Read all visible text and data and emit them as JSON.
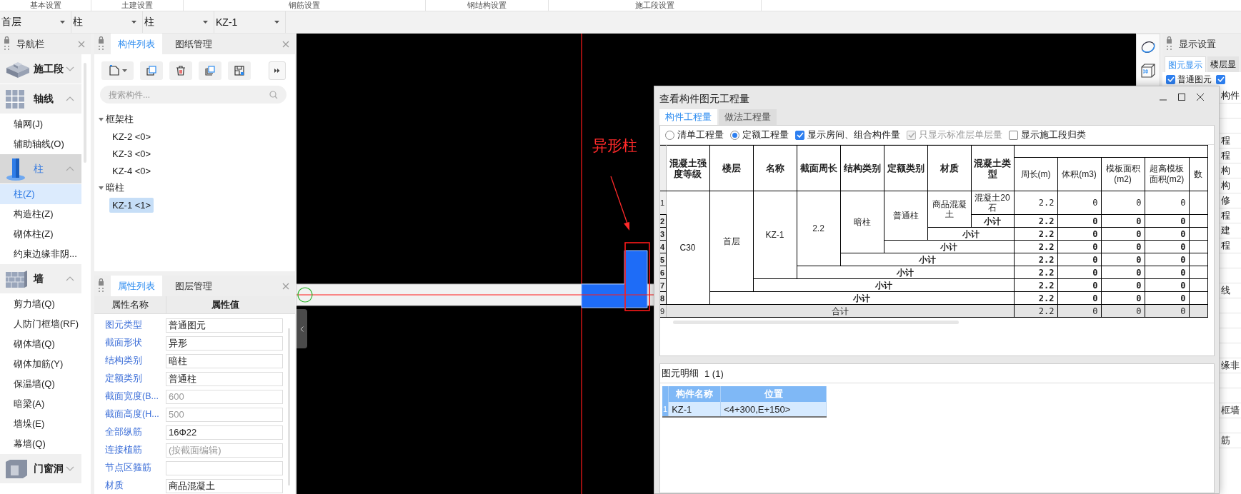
{
  "top_tabs": [
    {
      "label": "基本设置"
    },
    {
      "label": "土建设置"
    },
    {
      "label": "钢筋设置"
    },
    {
      "label": "钢结构设置"
    },
    {
      "label": "施工段设置"
    }
  ],
  "selectors": [
    {
      "value": "首层"
    },
    {
      "value": "柱"
    },
    {
      "value": "柱"
    },
    {
      "value": "KZ-1"
    }
  ],
  "navigation": {
    "title": "导航栏",
    "groups": [
      {
        "label": "施工段",
        "expanded": false,
        "selected": false
      },
      {
        "label": "轴线",
        "expanded": true,
        "selected": false,
        "items": [
          {
            "label": "轴网(J)",
            "selected": false
          },
          {
            "label": "辅助轴线(O)",
            "selected": false
          }
        ]
      },
      {
        "label": "柱",
        "expanded": true,
        "selected": true,
        "items": [
          {
            "label": "柱(Z)",
            "selected": true
          },
          {
            "label": "构造柱(Z)",
            "selected": false
          },
          {
            "label": "砌体柱(Z)",
            "selected": false
          },
          {
            "label": "约束边缘非阴...",
            "selected": false
          }
        ]
      },
      {
        "label": "墙",
        "expanded": true,
        "selected": false,
        "items": [
          {
            "label": "剪力墙(Q)",
            "selected": false
          },
          {
            "label": "人防门框墙(RF)",
            "selected": false
          },
          {
            "label": "砌体墙(Q)",
            "selected": false
          },
          {
            "label": "砌体加筋(Y)",
            "selected": false
          },
          {
            "label": "保温墙(Q)",
            "selected": false
          },
          {
            "label": "暗梁(A)",
            "selected": false
          },
          {
            "label": "墙垛(E)",
            "selected": false
          },
          {
            "label": "幕墙(Q)",
            "selected": false
          }
        ]
      },
      {
        "label": "门窗洞",
        "expanded": false,
        "selected": false
      }
    ]
  },
  "component_panel": {
    "tabs": [
      {
        "label": "构件列表",
        "selected": true
      },
      {
        "label": "图纸管理",
        "selected": false
      }
    ],
    "search": {
      "placeholder": "搜索构件..."
    },
    "tree": [
      {
        "label": "框架柱",
        "expanded": true,
        "children": [
          {
            "label": "KZ-2 <0>",
            "selected": false
          },
          {
            "label": "KZ-3 <0>",
            "selected": false
          },
          {
            "label": "KZ-4 <0>",
            "selected": false
          }
        ]
      },
      {
        "label": "暗柱",
        "expanded": true,
        "children": [
          {
            "label": "KZ-1 <1>",
            "selected": true
          }
        ]
      }
    ]
  },
  "properties_panel": {
    "tabs": [
      {
        "label": "属性列表",
        "selected": true
      },
      {
        "label": "图层管理",
        "selected": false
      }
    ],
    "columns": [
      "属性名称",
      "属性值"
    ],
    "rows": [
      {
        "name": "图元类型",
        "value": "普通图元",
        "disabled": false
      },
      {
        "name": "截面形状",
        "value": "异形",
        "disabled": false
      },
      {
        "name": "结构类别",
        "value": "暗柱",
        "disabled": false
      },
      {
        "name": "定额类别",
        "value": "普通柱",
        "disabled": false
      },
      {
        "name": "截面宽度(B...",
        "value": "600",
        "disabled": true
      },
      {
        "name": "截面高度(H...",
        "value": "500",
        "disabled": true
      },
      {
        "name": "全部纵筋",
        "value": "16Φ22",
        "disabled": false
      },
      {
        "name": "连接植筋",
        "value": "(按截面编辑)",
        "disabled": true
      },
      {
        "name": "节点区箍筋"
      },
      {
        "name": "材质",
        "value": "商品混凝土",
        "disabled": false
      }
    ]
  },
  "canvas": {
    "annotation": "异形柱"
  },
  "display_settings": {
    "title": "显示设置",
    "tabs": [
      {
        "label": "图元显示",
        "selected": true
      },
      {
        "label": "楼层显",
        "selected": false
      }
    ],
    "options": [
      {
        "label": "普通图元",
        "checked": true
      },
      {
        "checked": true
      }
    ],
    "rows": [
      {
        "kind": "text",
        "text": "构件"
      },
      {
        "kind": "blank"
      },
      {
        "kind": "blank"
      },
      {
        "kind": "text",
        "text": "程"
      },
      {
        "kind": "text",
        "text": "程"
      },
      {
        "kind": "text",
        "text": "构"
      },
      {
        "kind": "text",
        "text": "构"
      },
      {
        "kind": "text",
        "text": "修"
      },
      {
        "kind": "text",
        "text": "程"
      },
      {
        "kind": "text",
        "text": "建"
      },
      {
        "kind": "text",
        "text": "程"
      },
      {
        "kind": "blank"
      },
      {
        "kind": "blank"
      },
      {
        "kind": "text",
        "text": "线"
      },
      {
        "kind": "blank"
      },
      {
        "kind": "blank"
      },
      {
        "kind": "blank"
      },
      {
        "kind": "blank"
      },
      {
        "kind": "text",
        "text": "缘非"
      },
      {
        "kind": "blank"
      },
      {
        "kind": "blank"
      },
      {
        "kind": "text",
        "text": "框墙"
      },
      {
        "kind": "blank"
      },
      {
        "kind": "text",
        "text": "筋"
      }
    ]
  },
  "dialog": {
    "title": "查看构件图元工程量",
    "tabs": [
      {
        "label": "构件工程量",
        "selected": true
      },
      {
        "label": "做法工程量",
        "selected": false
      }
    ],
    "options": [
      {
        "kind": "radio",
        "label": "清单工程量",
        "selected": false
      },
      {
        "kind": "radio",
        "label": "定额工程量",
        "selected": true
      },
      {
        "kind": "checkbox",
        "label": "显示房间、组合构件量",
        "checked": true,
        "disabled": false
      },
      {
        "kind": "checkbox",
        "label": "只显示标准层单层量",
        "checked": true,
        "disabled": true
      },
      {
        "kind": "checkbox",
        "label": "显示施工段归类",
        "checked": false,
        "disabled": false
      }
    ],
    "table": {
      "columns": [
        "混凝土强度等级",
        "楼层",
        "名称",
        "截面周长",
        "结构类别",
        "定额类别",
        "材质",
        "混凝土类型"
      ],
      "value_columns": [
        "周长(m)",
        "体积(m3)",
        "模板面积(m2)",
        "超高模板面积(m2)",
        "数"
      ],
      "rows": [
        {
          "number": "1",
          "kind": "detail",
          "cells": [
            {
              "text": "C30",
              "rowspan": 8
            },
            {
              "text": "首层",
              "rowspan": 7
            },
            {
              "text": "KZ-1",
              "rowspan": 6
            },
            {
              "text": "2.2",
              "rowspan": 5
            },
            {
              "text": "暗柱",
              "rowspan": 4
            },
            {
              "text": "普通柱",
              "rowspan": 3
            },
            {
              "text": "商品混凝土",
              "rowspan": 2
            },
            {
              "text": "混凝土20石"
            }
          ],
          "values": [
            "2.2",
            "0",
            "0",
            "0"
          ]
        },
        {
          "number": "2",
          "kind": "subtotal",
          "cells": [
            {
              "text": "小计"
            }
          ],
          "values": [
            "2.2",
            "0",
            "0",
            "0"
          ]
        },
        {
          "number": "3",
          "kind": "subtotal",
          "cells": [
            {
              "text": "小计",
              "colspan": 2
            }
          ],
          "values": [
            "2.2",
            "0",
            "0",
            "0"
          ]
        },
        {
          "number": "4",
          "kind": "subtotal",
          "cells": [
            {
              "text": "小计",
              "colspan": 3
            }
          ],
          "values": [
            "2.2",
            "0",
            "0",
            "0"
          ]
        },
        {
          "number": "5",
          "kind": "subtotal",
          "cells": [
            {
              "text": "小计",
              "colspan": 4
            }
          ],
          "values": [
            "2.2",
            "0",
            "0",
            "0"
          ]
        },
        {
          "number": "6",
          "kind": "subtotal",
          "cells": [
            {
              "text": "小计",
              "colspan": 5
            }
          ],
          "values": [
            "2.2",
            "0",
            "0",
            "0"
          ]
        },
        {
          "number": "7",
          "kind": "subtotal",
          "cells": [
            {
              "text": "小计",
              "colspan": 6
            }
          ],
          "values": [
            "2.2",
            "0",
            "0",
            "0"
          ]
        },
        {
          "number": "8",
          "kind": "subtotal",
          "cells": [
            {
              "text": "小计",
              "colspan": 7
            }
          ],
          "values": [
            "2.2",
            "0",
            "0",
            "0"
          ]
        },
        {
          "number": "9",
          "kind": "total",
          "cells": [
            {
              "text": "合计",
              "colspan": 8
            }
          ],
          "values": [
            "2.2",
            "0",
            "0",
            "0"
          ]
        }
      ]
    },
    "detail": {
      "title": "图元明细",
      "count": "1 (1)",
      "columns": [
        "构件名称",
        "位置"
      ],
      "rows": [
        {
          "number": "1",
          "cells": [
            "KZ-1",
            "<4+300,E+150>"
          ],
          "selected": true
        }
      ]
    }
  }
}
